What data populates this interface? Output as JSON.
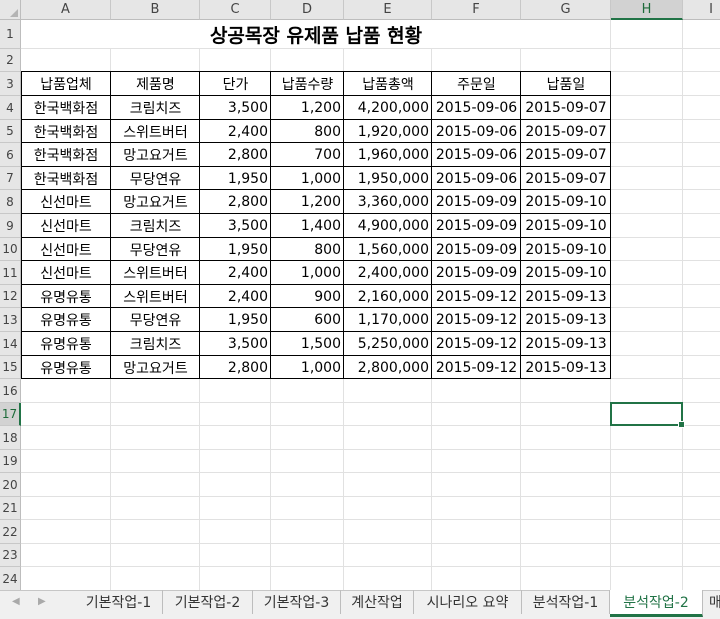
{
  "columns": [
    "A",
    "B",
    "C",
    "D",
    "E",
    "F",
    "G",
    "H",
    "I"
  ],
  "selected_column": "H",
  "selected_row": "17",
  "row_numbers": [
    "1",
    "2",
    "3",
    "4",
    "5",
    "6",
    "7",
    "8",
    "9",
    "10",
    "11",
    "12",
    "13",
    "14",
    "15",
    "16",
    "17",
    "18",
    "19",
    "20",
    "21",
    "22",
    "23",
    "24"
  ],
  "title": "상공목장 유제품 납품 현황",
  "table": {
    "headers": [
      "납품업체",
      "제품명",
      "단가",
      "납품수량",
      "납품총액",
      "주문일",
      "납품일"
    ],
    "rows": [
      [
        "한국백화점",
        "크림치즈",
        "3,500",
        "1,200",
        "4,200,000",
        "2015-09-06",
        "2015-09-07"
      ],
      [
        "한국백화점",
        "스위트버터",
        "2,400",
        "800",
        "1,920,000",
        "2015-09-06",
        "2015-09-07"
      ],
      [
        "한국백화점",
        "망고요거트",
        "2,800",
        "700",
        "1,960,000",
        "2015-09-06",
        "2015-09-07"
      ],
      [
        "한국백화점",
        "무당연유",
        "1,950",
        "1,000",
        "1,950,000",
        "2015-09-06",
        "2015-09-07"
      ],
      [
        "신선마트",
        "망고요거트",
        "2,800",
        "1,200",
        "3,360,000",
        "2015-09-09",
        "2015-09-10"
      ],
      [
        "신선마트",
        "크림치즈",
        "3,500",
        "1,400",
        "4,900,000",
        "2015-09-09",
        "2015-09-10"
      ],
      [
        "신선마트",
        "무당연유",
        "1,950",
        "800",
        "1,560,000",
        "2015-09-09",
        "2015-09-10"
      ],
      [
        "신선마트",
        "스위트버터",
        "2,400",
        "1,000",
        "2,400,000",
        "2015-09-09",
        "2015-09-10"
      ],
      [
        "유명유통",
        "스위트버터",
        "2,400",
        "900",
        "2,160,000",
        "2015-09-12",
        "2015-09-13"
      ],
      [
        "유명유통",
        "무당연유",
        "1,950",
        "600",
        "1,170,000",
        "2015-09-12",
        "2015-09-13"
      ],
      [
        "유명유통",
        "크림치즈",
        "3,500",
        "1,500",
        "5,250,000",
        "2015-09-12",
        "2015-09-13"
      ],
      [
        "유명유통",
        "망고요거트",
        "2,800",
        "1,000",
        "2,800,000",
        "2015-09-12",
        "2015-09-13"
      ]
    ]
  },
  "sheet_tabs": [
    "기본작업-1",
    "기본작업-2",
    "기본작업-3",
    "계산작업",
    "시나리오 요약",
    "분석작업-1",
    "분석작업-2",
    "매"
  ],
  "active_tab": "분석작업-2",
  "nav_prev": "◀",
  "nav_next": "▶",
  "colors": {
    "accent": "#217346"
  }
}
